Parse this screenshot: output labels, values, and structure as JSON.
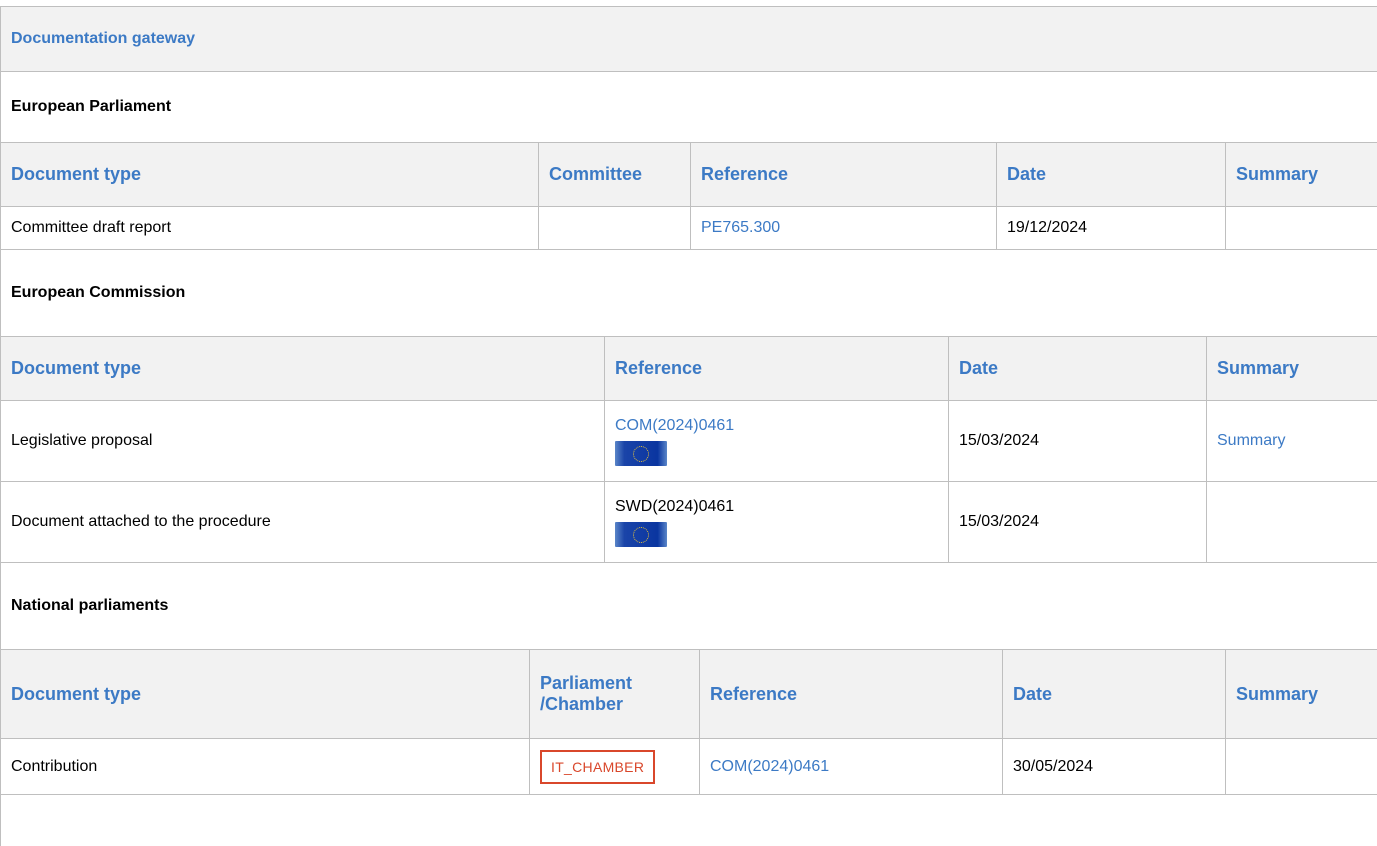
{
  "gateway": {
    "title": "Documentation gateway"
  },
  "european_parliament": {
    "title": "European Parliament",
    "headers": [
      "Document type",
      "Committee",
      "Reference",
      "Date",
      "Summary"
    ],
    "rows": [
      {
        "doc_type": "Committee draft report",
        "committee": "",
        "reference": "PE765.300",
        "date": "19/12/2024",
        "summary": ""
      }
    ]
  },
  "european_commission": {
    "title": "European Commission",
    "headers": [
      "Document type",
      "Reference",
      "Date",
      "Summary"
    ],
    "rows": [
      {
        "doc_type": "Legislative proposal",
        "reference": "COM(2024)0461",
        "reference_is_link": true,
        "flag_icon": "eu-flag-icon",
        "date": "15/03/2024",
        "summary": "Summary"
      },
      {
        "doc_type": "Document attached to the procedure",
        "reference": "SWD(2024)0461",
        "reference_is_link": false,
        "flag_icon": "eu-flag-icon",
        "date": "15/03/2024",
        "summary": ""
      }
    ]
  },
  "national_parliaments": {
    "title": "National parliaments",
    "headers": [
      "Document type",
      "Parliament\n/Chamber",
      "Reference",
      "Date",
      "Summary"
    ],
    "header_parliament_line1": "Parliament",
    "header_parliament_line2": "/Chamber",
    "rows": [
      {
        "doc_type": "Contribution",
        "chamber": "IT_CHAMBER",
        "reference": "COM(2024)0461",
        "date": "30/05/2024",
        "summary": ""
      }
    ]
  },
  "colors": {
    "link": "#3c7ac5",
    "header_bg": "#f2f2f2",
    "border": "#bfbfbf",
    "badge": "#d9472b"
  }
}
